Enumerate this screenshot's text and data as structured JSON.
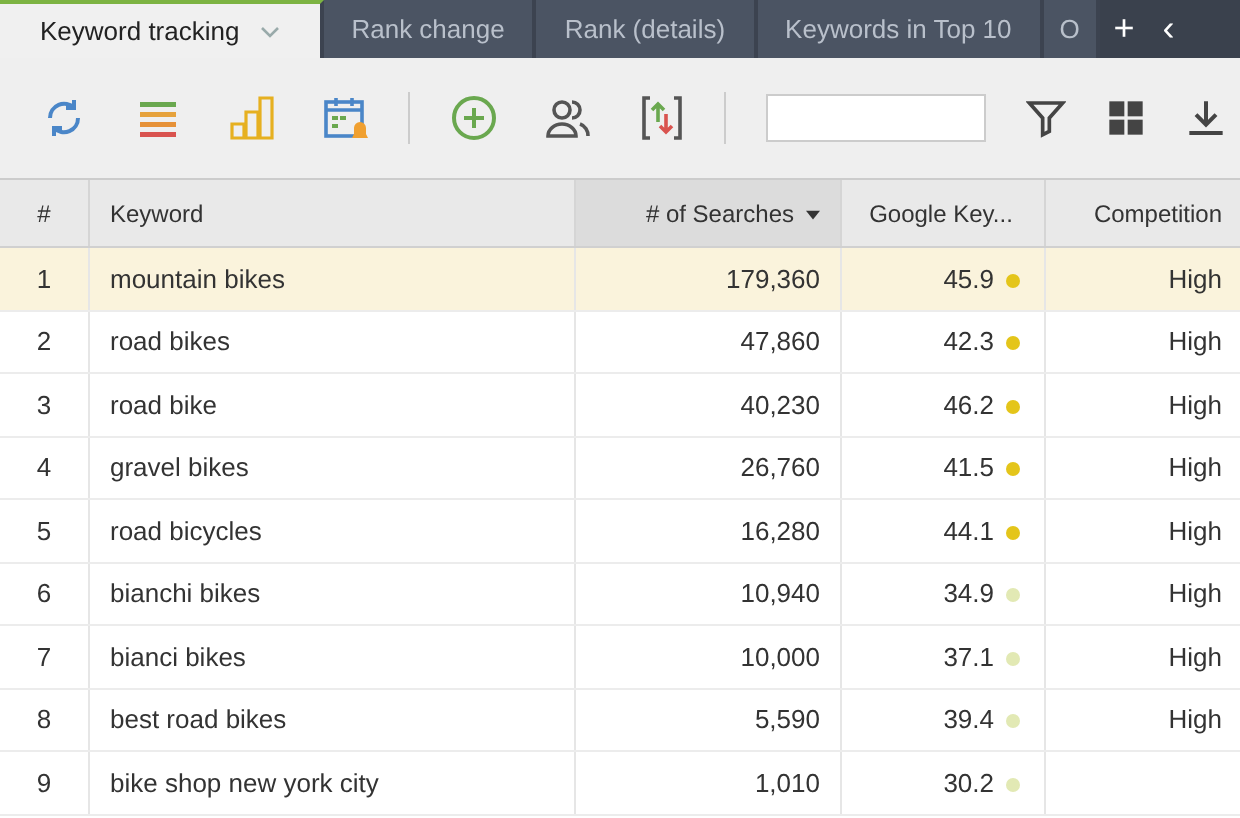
{
  "tabs": [
    {
      "label": "Keyword tracking",
      "selected": true
    },
    {
      "label": "Rank change",
      "selected": false
    },
    {
      "label": "Rank (details)",
      "selected": false
    },
    {
      "label": "Keywords in Top 10",
      "selected": false
    },
    {
      "label": "O",
      "selected": false
    }
  ],
  "tab_actions": [
    "+",
    "‹"
  ],
  "table": {
    "columns": [
      {
        "label": "#",
        "sorted": false
      },
      {
        "label": "Keyword",
        "sorted": false
      },
      {
        "label": "# of Searches",
        "sorted": true
      },
      {
        "label": "Google Key...",
        "sorted": false
      },
      {
        "label": "Competition",
        "sorted": false
      }
    ],
    "rows": [
      {
        "n": "1",
        "keyword": "mountain bikes",
        "searches": "179,360",
        "kei": "45.9",
        "color": "#e4c51a",
        "competition": "High",
        "selected": true
      },
      {
        "n": "2",
        "keyword": "road bikes",
        "searches": "47,860",
        "kei": "42.3",
        "color": "#e4c51a",
        "competition": "High",
        "selected": false
      },
      {
        "n": "3",
        "keyword": "road bike",
        "searches": "40,230",
        "kei": "46.2",
        "color": "#e4c51a",
        "competition": "High",
        "selected": false
      },
      {
        "n": "4",
        "keyword": "gravel bikes",
        "searches": "26,760",
        "kei": "41.5",
        "color": "#e4c51a",
        "competition": "High",
        "selected": false
      },
      {
        "n": "5",
        "keyword": "road bicycles",
        "searches": "16,280",
        "kei": "44.1",
        "color": "#e4c51a",
        "competition": "High",
        "selected": false
      },
      {
        "n": "6",
        "keyword": "bianchi bikes",
        "searches": "10,940",
        "kei": "34.9",
        "color": "#e2e9b4",
        "competition": "High",
        "selected": false
      },
      {
        "n": "7",
        "keyword": "bianci bikes",
        "searches": "10,000",
        "kei": "37.1",
        "color": "#e2e9b4",
        "competition": "High",
        "selected": false
      },
      {
        "n": "8",
        "keyword": "best road bikes",
        "searches": "5,590",
        "kei": "39.4",
        "color": "#e2e9b4",
        "competition": "High",
        "selected": false
      },
      {
        "n": "9",
        "keyword": "bike shop new york city",
        "searches": "1,010",
        "kei": "30.2",
        "color": "#e2e9b4",
        "selected": false
      }
    ]
  }
}
